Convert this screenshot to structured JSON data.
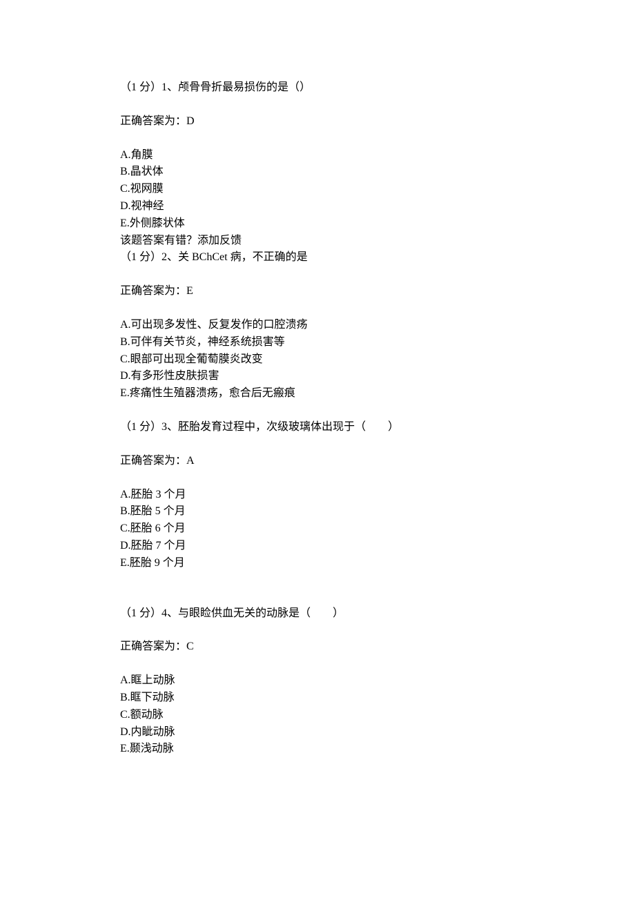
{
  "q1": {
    "header": "（1 分）1、颅骨骨折最易损伤的是（）",
    "answer_label": "正确答案为：D",
    "optA": "A.角膜",
    "optB": "B.晶状体",
    "optC": "C.视网膜",
    "optD": "D.视神经",
    "optE": "E.外侧膝状体",
    "feedback": "该题答案有错？添加反馈"
  },
  "q2": {
    "header": "（1 分）2、关 BChCet 病，不正确的是",
    "answer_label": "正确答案为：E",
    "optA": "A.可出现多发性、反复发作的口腔溃疡",
    "optB": "B.可伴有关节炎，神经系统损害等",
    "optC": "C.眼部可出现全葡萄膜炎改变",
    "optD": "D.有多形性皮肤损害",
    "optE": "E.疼痛性生殖器溃疡，愈合后无瘢痕"
  },
  "q3": {
    "header": "（1 分）3、胚胎发育过程中，次级玻璃体出现于（　　）",
    "answer_label": "正确答案为：A",
    "optA": "A.胚胎 3 个月",
    "optB": "B.胚胎 5 个月",
    "optC": "C.胚胎 6 个月",
    "optD": "D.胚胎 7 个月",
    "optE": "E.胚胎 9 个月"
  },
  "q4": {
    "header": "（1 分）4、与眼睑供血无关的动脉是（　　）",
    "answer_label": "正确答案为：C",
    "optA": "A.眶上动脉",
    "optB": "B.眶下动脉",
    "optC": "C.额动脉",
    "optD": "D.内眦动脉",
    "optE": "E.颞浅动脉"
  }
}
